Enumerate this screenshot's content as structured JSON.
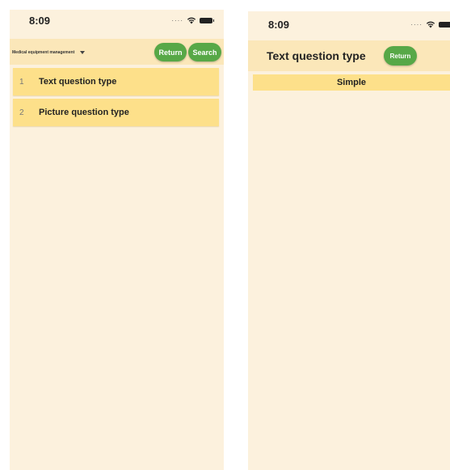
{
  "left_screen": {
    "status_time": "8:09",
    "category_select": "Medical equipment management",
    "return_label": "Return",
    "search_label": "Search",
    "question_types": [
      {
        "index": "1",
        "label": "Text question type"
      },
      {
        "index": "2",
        "label": "Picture question type"
      }
    ]
  },
  "right_screen": {
    "status_time": "8:09",
    "title": "Text question type",
    "return_label": "Return",
    "level_label": "Simple"
  },
  "colors": {
    "background": "#fcf1dd",
    "header": "#fbe7b9",
    "list_item": "#fde08a",
    "button": "#57a847"
  },
  "icons": {
    "wifi": "wifi-icon",
    "battery": "battery-icon",
    "dropdown": "chevron-down-icon"
  }
}
